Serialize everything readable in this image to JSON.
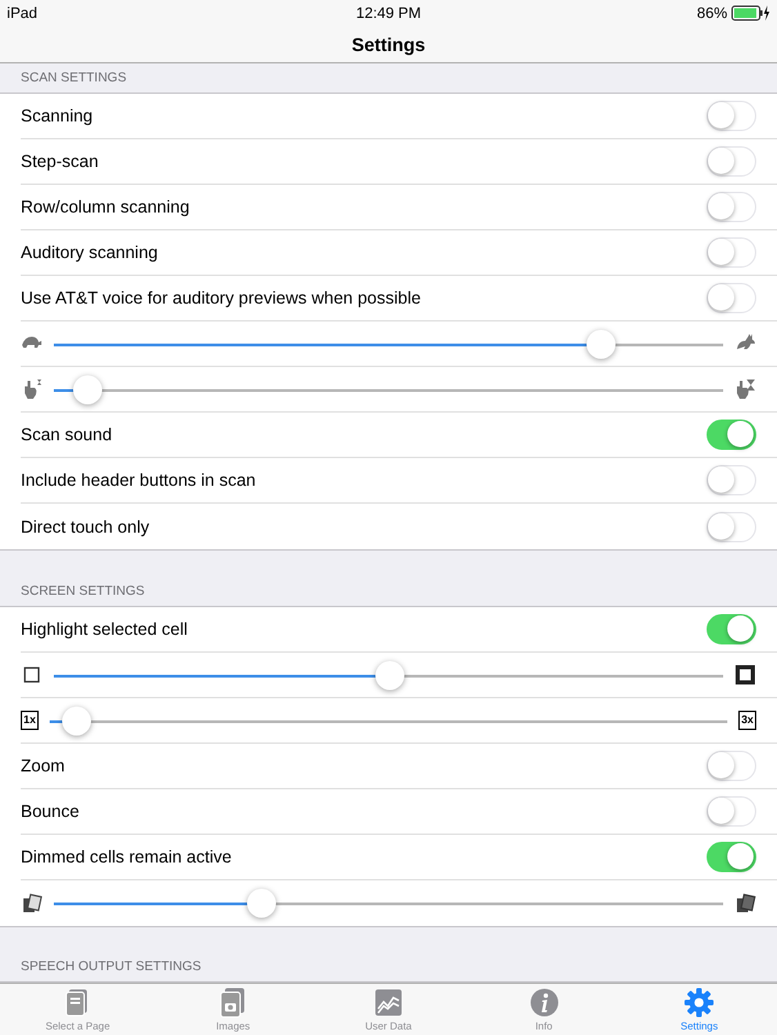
{
  "status_bar": {
    "device": "iPad",
    "time": "12:49 PM",
    "battery": "86%"
  },
  "nav_bar": {
    "title": "Settings"
  },
  "sections": [
    {
      "header": "SCAN SETTINGS",
      "items": [
        {
          "kind": "toggle",
          "label": "Scanning",
          "on": false
        },
        {
          "kind": "toggle",
          "label": "Step-scan",
          "on": false
        },
        {
          "kind": "toggle",
          "label": "Row/column scanning",
          "on": false
        },
        {
          "kind": "toggle",
          "label": "Auditory scanning",
          "on": false
        },
        {
          "kind": "toggle",
          "label": "Use AT&T voice for auditory previews when possible",
          "on": false
        },
        {
          "kind": "slider",
          "level": 0.83
        },
        {
          "kind": "slider",
          "level": 0.03
        },
        {
          "kind": "toggle",
          "label": "Scan sound",
          "on": true
        },
        {
          "kind": "toggle",
          "label": "Include header buttons in scan",
          "on": false
        },
        {
          "kind": "toggle",
          "label": "Direct touch only",
          "on": false
        }
      ]
    },
    {
      "header": "SCREEN SETTINGS",
      "items": [
        {
          "kind": "toggle",
          "label": "Highlight selected cell",
          "on": true
        },
        {
          "kind": "slider",
          "level": 0.5
        },
        {
          "kind": "slider",
          "level": 0.02,
          "min_label": "1x",
          "max_label": "3x"
        },
        {
          "kind": "toggle",
          "label": "Zoom",
          "on": false
        },
        {
          "kind": "toggle",
          "label": "Bounce",
          "on": false
        },
        {
          "kind": "toggle",
          "label": "Dimmed cells remain active",
          "on": true
        },
        {
          "kind": "slider",
          "level": 0.3
        }
      ]
    },
    {
      "header": "SPEECH OUTPUT SETTINGS"
    }
  ],
  "tab_bar": [
    {
      "label": "Select a Page",
      "selected": false
    },
    {
      "label": "Images",
      "selected": false
    },
    {
      "label": "User Data",
      "selected": false
    },
    {
      "label": "Info",
      "selected": false
    },
    {
      "label": "Settings",
      "selected": true
    }
  ]
}
